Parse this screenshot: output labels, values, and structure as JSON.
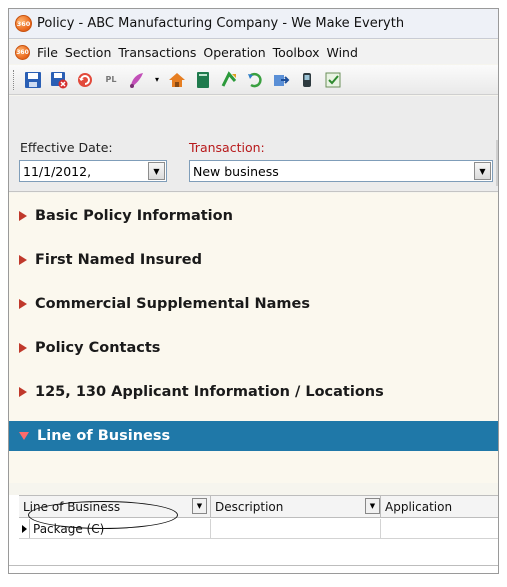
{
  "window": {
    "title": "Policy - ABC Manufacturing Company - We Make Everyth",
    "logo_text": "360"
  },
  "menu": {
    "items": [
      "File",
      "Section",
      "Transactions",
      "Operation",
      "Toolbox",
      "Wind"
    ]
  },
  "toolbar": {
    "icons": [
      "save-icon",
      "save-close-icon",
      "undo-icon",
      "pl-icon",
      "paint-icon",
      "dropdown-icon",
      "home-icon",
      "book-icon",
      "refresh-icon",
      "redo-icon",
      "export-icon",
      "phone-icon",
      "checklist-icon"
    ],
    "pl_label": "PL"
  },
  "fields": {
    "effective_date_label": "Effective Date:",
    "effective_date_value": "11/1/2012,",
    "transaction_label": "Transaction:",
    "transaction_value": "New business"
  },
  "sections": [
    {
      "label": "Basic Policy Information",
      "expanded": false
    },
    {
      "label": "First Named Insured",
      "expanded": false
    },
    {
      "label": "Commercial Supplemental Names",
      "expanded": false
    },
    {
      "label": "Policy Contacts",
      "expanded": false
    },
    {
      "label": "125, 130 Applicant Information / Locations",
      "expanded": false
    },
    {
      "label": "Line of Business",
      "expanded": true
    }
  ],
  "grid": {
    "columns": [
      "Line of Business",
      "Description",
      "Application"
    ],
    "rows": [
      [
        "Package (C)",
        "",
        ""
      ]
    ]
  },
  "colors": {
    "active_section_bg": "#1f78a8",
    "transaction_label": "#b8191b",
    "collapsed_arrow": "#c0392b"
  }
}
